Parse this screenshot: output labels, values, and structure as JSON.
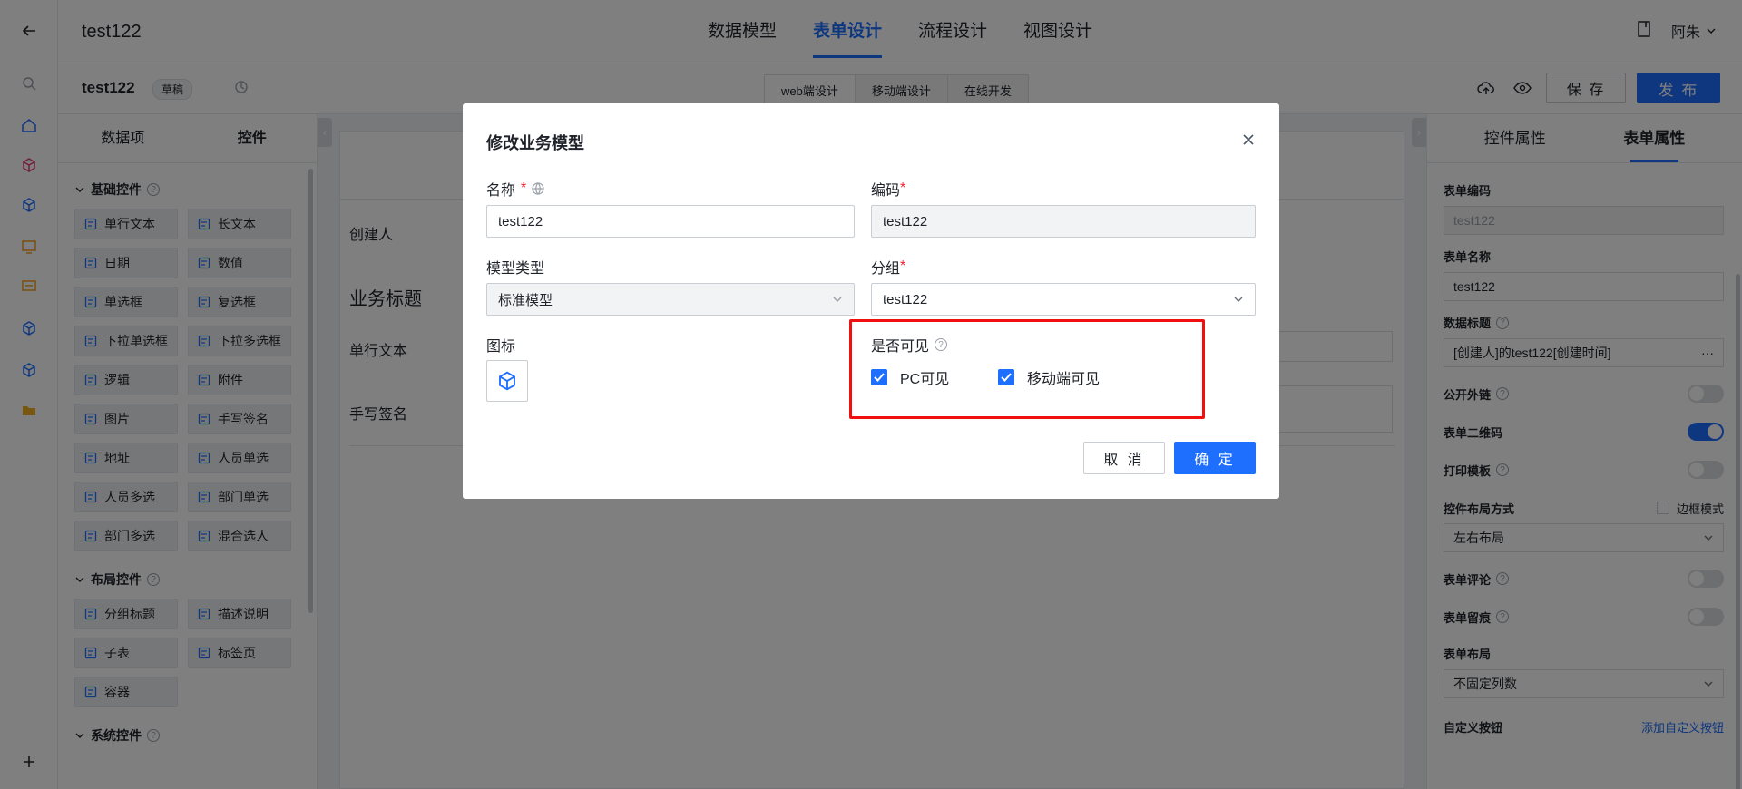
{
  "app": {
    "title": "test122"
  },
  "main_tabs": [
    {
      "label": "数据模型"
    },
    {
      "label": "表单设计"
    },
    {
      "label": "流程设计"
    },
    {
      "label": "视图设计"
    }
  ],
  "user": {
    "name": "阿朱"
  },
  "subbar": {
    "form_name": "test122",
    "status": "草稿",
    "modes": [
      {
        "label": "web端设计"
      },
      {
        "label": "移动端设计"
      },
      {
        "label": "在线开发"
      }
    ],
    "save_label": "保 存",
    "publish_label": "发 布"
  },
  "left_panel": {
    "tabs": [
      {
        "label": "数据项"
      },
      {
        "label": "控件"
      }
    ],
    "groups": [
      {
        "title": "基础控件",
        "items": [
          "单行文本",
          "长文本",
          "日期",
          "数值",
          "单选框",
          "复选框",
          "下拉单选框",
          "下拉多选框",
          "逻辑",
          "附件",
          "图片",
          "手写签名",
          "地址",
          "人员单选",
          "人员多选",
          "部门单选",
          "部门多选",
          "混合选人"
        ]
      },
      {
        "title": "布局控件",
        "items": [
          "分组标题",
          "描述说明",
          "子表",
          "标签页",
          "容器"
        ]
      },
      {
        "title": "系统控件",
        "items": []
      }
    ]
  },
  "canvas": {
    "rows": [
      {
        "label": "创建人"
      },
      {
        "label": "业务标题"
      },
      {
        "label": "单行文本"
      },
      {
        "label": "手写签名"
      }
    ]
  },
  "right_panel": {
    "tabs": [
      {
        "label": "控件属性"
      },
      {
        "label": "表单属性"
      }
    ],
    "form_code_label": "表单编码",
    "form_code_value": "test122",
    "form_name_label": "表单名称",
    "form_name_value": "test122",
    "data_title_label": "数据标题",
    "data_title_value": "[创建人]的test122[创建时间]",
    "public_link_label": "公开外链",
    "qrcode_label": "表单二维码",
    "print_label": "打印模板",
    "layout_mode_label": "控件布局方式",
    "border_mode_label": "边框模式",
    "layout_mode_value": "左右布局",
    "comment_label": "表单评论",
    "trace_label": "表单留痕",
    "form_layout_label": "表单布局",
    "form_layout_value": "不固定列数",
    "custom_btn_label": "自定义按钮",
    "add_custom_btn_label": "添加自定义按钮",
    "switches": {
      "public_link": false,
      "qrcode": true,
      "print": false,
      "comment": false,
      "trace": false
    }
  },
  "modal": {
    "title": "修改业务模型",
    "name_label": "名称",
    "name_value": "test122",
    "code_label": "编码",
    "code_value": "test122",
    "model_type_label": "模型类型",
    "model_type_value": "标准模型",
    "group_label": "分组",
    "group_value": "test122",
    "icon_label": "图标",
    "visible_label": "是否可见",
    "pc_visible_label": "PC可见",
    "mobile_visible_label": "移动端可见",
    "pc_visible": true,
    "mobile_visible": true,
    "cancel_label": "取 消",
    "ok_label": "确 定"
  },
  "colors": {
    "primary": "#1f6fff",
    "highlight": "#f01010",
    "required": "#f5222d"
  }
}
